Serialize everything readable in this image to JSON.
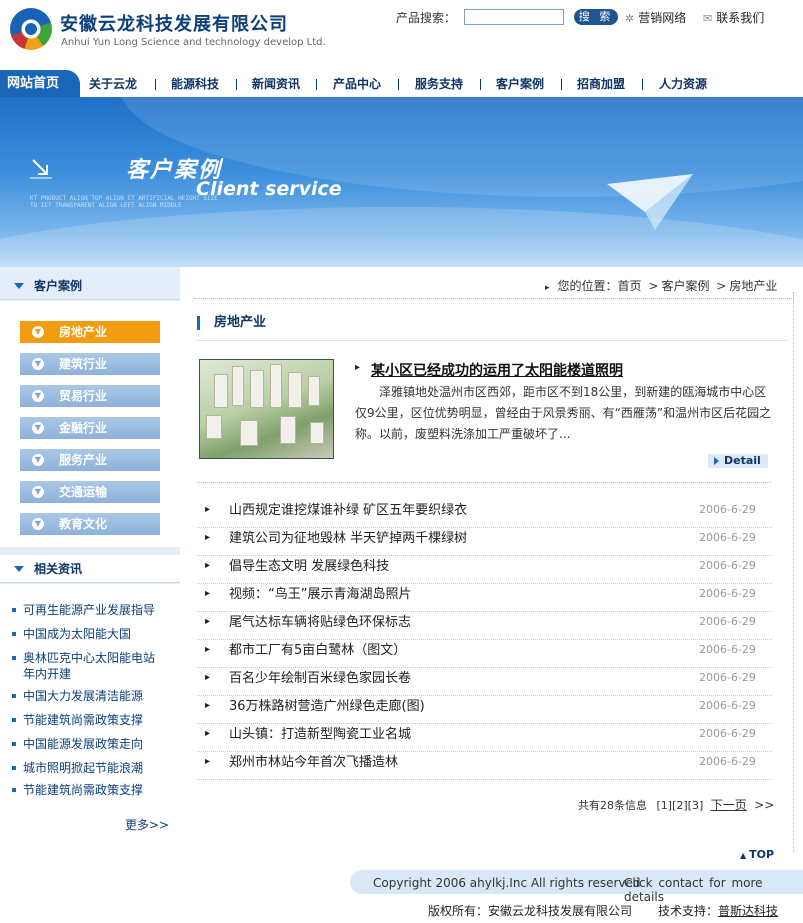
{
  "header": {
    "company_name": "安徽云龙科技发展有限公司",
    "company_en": "Anhui Yun Long Science and technology develop Ltd.",
    "search_label": "产品搜索：",
    "search_value": "",
    "search_button": "搜 索",
    "marketing_link": "营销网络",
    "contact_link": "联系我们"
  },
  "nav": {
    "home": "网站首页",
    "items": [
      "关于云龙",
      "能源科技",
      "新闻资讯",
      "产品中心",
      "服务支持",
      "客户案例",
      "招商加盟",
      "人力资源"
    ]
  },
  "banner": {
    "title_cn": "客户案例",
    "title_en": "Client service",
    "small_text": "KT PRODUCT ALIGN TOP ALIGN CT ARTIFICIAL HEIGHT SIZE TO ICT TRANSPARENT ALIGN LEFT ALIGN MIDDLE"
  },
  "sidebar": {
    "cases_heading": "客户案例",
    "categories": [
      "房地产业",
      "建筑行业",
      "贸易行业",
      "金融行业",
      "服务产业",
      "交通运输",
      "教育文化"
    ],
    "active_category": "房地产业",
    "news_heading": "相关资讯",
    "news": [
      "可再生能源产业发展指导",
      "中国成为太阳能大国",
      "奥林匹克中心太阳能电站年内开建",
      "中国大力发展清洁能源",
      "节能建筑尚需政策支撑",
      "中国能源发展政策走向",
      "城市照明掀起节能浪潮",
      "节能建筑尚需政策支撑"
    ],
    "more": "更多>>"
  },
  "breadcrumb": {
    "prefix": "您的位置：",
    "home": "首页",
    "section": "客户案例",
    "current": "房地产业",
    "sep": ">"
  },
  "main": {
    "page_title": "房地产业",
    "featured": {
      "title": "某小区已经成功的运用了太阳能楼道照明",
      "desc": "泽雅镇地处温州市区西郊，距市区不到18公里，到新建的瓯海城市中心区仅9公里，区位优势明显，曾经由于风景秀丽、有“西雁荡”和温州市区后花园之称。以前，废塑料洗涤加工严重破坏了...",
      "detail_btn": "Detail"
    },
    "articles": [
      {
        "title": "山西规定谁挖煤谁补绿 矿区五年要织绿衣",
        "date": "2006-6-29"
      },
      {
        "title": "建筑公司为征地毁林 半天铲掉两千棵绿树",
        "date": "2006-6-29"
      },
      {
        "title": "倡导生态文明 发展绿色科技",
        "date": "2006-6-29"
      },
      {
        "title": "视频：“鸟王”展示青海湖岛照片",
        "date": "2006-6-29"
      },
      {
        "title": "尾气达标车辆将贴绿色环保标志",
        "date": "2006-6-29"
      },
      {
        "title": "都市工厂有5亩白鹭林（图文）",
        "date": "2006-6-29"
      },
      {
        "title": "百名少年绘制百米绿色家园长卷",
        "date": "2006-6-29"
      },
      {
        "title": "36万株路树营造广州绿色走廊(图)",
        "date": "2006-6-29"
      },
      {
        "title": "山头镇：打造新型陶瓷工业名城",
        "date": "2006-6-29"
      },
      {
        "title": "郑州市林站今年首次飞播造林",
        "date": "2006-6-29"
      }
    ],
    "pager": {
      "summary": "共有28条信息",
      "pages": "[1][2][3]",
      "next": "下一页",
      "next_icon": ">>"
    },
    "top_link": "TOP"
  },
  "footer": {
    "copyright": "Copyright 2006 ahylkj.Inc All rights reserved",
    "click_contact": "Click contact for more details",
    "owner": "版权所有：安徽云龙科技发展有限公司",
    "tech_label": "技术支持：",
    "tech_vendor": "普斯达科技"
  },
  "colors": {
    "brand_blue": "#1b67b7",
    "active_orange": "#f39c0f",
    "dark_navy": "#0d3566"
  },
  "icons": {
    "search_marker": "sun-icon",
    "contact": "envelope-icon",
    "arrow_marker": "triangle-right-icon"
  }
}
